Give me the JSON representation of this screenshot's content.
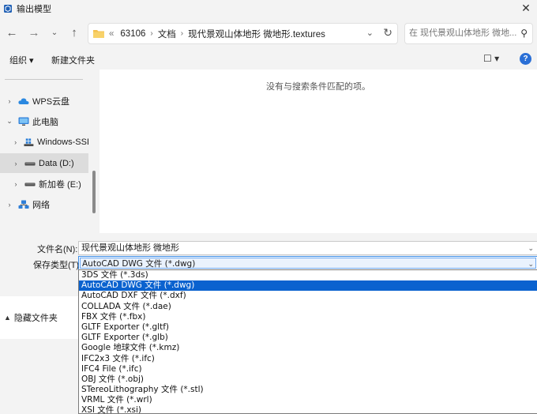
{
  "window": {
    "title": "输出模型",
    "close_glyph": "✕"
  },
  "nav": {
    "back_icon": "arrow-left-icon",
    "forward_icon": "arrow-right-icon",
    "recent_icon": "chevron-down-icon",
    "up_icon": "arrow-up-icon",
    "breadcrumb": {
      "overflow": "«",
      "items": [
        "63106",
        "文档",
        "现代景观山体地形 微地形.textures"
      ]
    },
    "search_placeholder": "在 现代景观山体地形 微地..."
  },
  "toolbar": {
    "organize": "组织 ▾",
    "new_folder": "新建文件夹",
    "view_glyph": "☐ ▾",
    "help_glyph": "?"
  },
  "sidebar": {
    "items": [
      {
        "label": "WPS云盘",
        "icon": "cloud-icon",
        "expand": "›"
      },
      {
        "label": "此电脑",
        "icon": "computer-icon",
        "expand": "⌄"
      },
      {
        "label": "Windows-SSD",
        "icon": "drive-icon",
        "expand": "›"
      },
      {
        "label": "Data (D:)",
        "icon": "drive-icon",
        "expand": "›",
        "selected": true
      },
      {
        "label": "新加卷 (E:)",
        "icon": "drive-icon",
        "expand": "›"
      },
      {
        "label": "网络",
        "icon": "network-icon",
        "expand": "›"
      }
    ]
  },
  "content": {
    "empty_message": "没有与搜索条件匹配的项。"
  },
  "form": {
    "filename_label": "文件名(N):",
    "filename_value": "现代景观山体地形 微地形",
    "type_label": "保存类型(T):",
    "type_value": "AutoCAD DWG 文件 (*.dwg)",
    "hide_folders": "隐藏文件夹"
  },
  "type_options": [
    "3DS 文件 (*.3ds)",
    "AutoCAD DWG 文件 (*.dwg)",
    "AutoCAD DXF 文件 (*.dxf)",
    "COLLADA 文件 (*.dae)",
    "FBX 文件 (*.fbx)",
    "GLTF Exporter (*.gltf)",
    "GLTF Exporter (*.glb)",
    "Google 地球文件 (*.kmz)",
    "IFC2x3 文件 (*.ifc)",
    "IFC4 File (*.ifc)",
    "OBJ 文件 (*.obj)",
    "STereoLithography 文件 (*.stl)",
    "VRML 文件 (*.wrl)",
    "XSI 文件 (*.xsi)"
  ],
  "selected_type_index": 1,
  "colors": {
    "accent": "#0a62cf",
    "help": "#2a6fd6",
    "folder": "#f4c150"
  }
}
